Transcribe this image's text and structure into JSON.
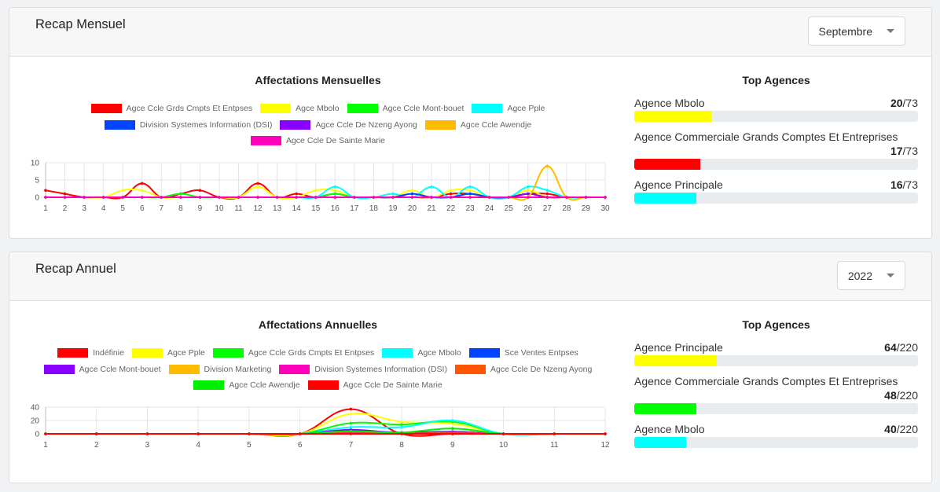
{
  "monthly": {
    "title": "Recap Mensuel",
    "selected_month": "Septembre",
    "top_title": "Top Agences",
    "top": [
      {
        "name": "Agence Mbolo",
        "value": "20",
        "total": "/73",
        "color": "#ffff00",
        "fraction": 0.274
      },
      {
        "name": "Agence Commerciale Grands Comptes Et Entreprises",
        "value": "17",
        "total": "/73",
        "color": "#ff0000",
        "fraction": 0.233
      },
      {
        "name": "Agence Principale",
        "value": "16",
        "total": "/73",
        "color": "#00ffff",
        "fraction": 0.219
      }
    ],
    "chart_data": {
      "type": "line",
      "title": "Affectations Mensuelles",
      "ylim": [
        0,
        10
      ],
      "yticks": [
        "0",
        "5",
        "10"
      ],
      "categories": [
        "1",
        "2",
        "3",
        "4",
        "5",
        "6",
        "7",
        "8",
        "9",
        "10",
        "11",
        "12",
        "13",
        "14",
        "15",
        "16",
        "17",
        "18",
        "19",
        "20",
        "21",
        "22",
        "23",
        "24",
        "25",
        "26",
        "27",
        "28",
        "29",
        "30"
      ],
      "series": [
        {
          "name": "Agce Ccle Grds Cmpts Et Entpses",
          "color": "#ff0000",
          "values": [
            2,
            1,
            0,
            0,
            0,
            4,
            0,
            1,
            2,
            0,
            0,
            4,
            0,
            1,
            0,
            1,
            0,
            0,
            0,
            0,
            0,
            1,
            1,
            0,
            0,
            1,
            1,
            0,
            0,
            0
          ]
        },
        {
          "name": "Agce Mbolo",
          "color": "#ffff00",
          "values": [
            0,
            0,
            0,
            0,
            2,
            2,
            0,
            0,
            0,
            0,
            0,
            3,
            0,
            0,
            2,
            2,
            0,
            0,
            0,
            2,
            0,
            2,
            2,
            0,
            0,
            2,
            0,
            0,
            0,
            0
          ]
        },
        {
          "name": "Agce Ccle Mont-bouet",
          "color": "#00ff00",
          "values": [
            0,
            0,
            0,
            0,
            0,
            0,
            0,
            1,
            0,
            0,
            0,
            0,
            0,
            0,
            0,
            1,
            0,
            0,
            0,
            0,
            0,
            0,
            1,
            0,
            0,
            0,
            0,
            0,
            0,
            0
          ]
        },
        {
          "name": "Agce Pple",
          "color": "#00ffff",
          "values": [
            0,
            0,
            0,
            0,
            0,
            0,
            0,
            0,
            0,
            0,
            0,
            0,
            0,
            0,
            0,
            3,
            0,
            0,
            1,
            0,
            3,
            0,
            3,
            0,
            0,
            3,
            2,
            0,
            0,
            0
          ]
        },
        {
          "name": "Division Systemes Information (DSI)",
          "color": "#0044ff",
          "values": [
            0,
            0,
            0,
            0,
            0,
            0,
            0,
            0,
            0,
            0,
            0,
            0,
            0,
            0,
            0,
            0,
            0,
            0,
            0,
            1,
            0,
            0,
            1,
            0,
            0,
            0,
            0,
            0,
            0,
            0
          ]
        },
        {
          "name": "Agce Ccle De Nzeng Ayong",
          "color": "#8800ff",
          "values": [
            0,
            0,
            0,
            0,
            0,
            0,
            0,
            0,
            0,
            0,
            0,
            0,
            0,
            0,
            0,
            0,
            0,
            0,
            0,
            0,
            0,
            0,
            0,
            0,
            0,
            1,
            0,
            0,
            0,
            0
          ]
        },
        {
          "name": "Agce Ccle Awendje",
          "color": "#ffbb00",
          "values": [
            0,
            0,
            0,
            0,
            0,
            0,
            0,
            0,
            0,
            0,
            0,
            0,
            0,
            0,
            0,
            0,
            0,
            0,
            0,
            0,
            0,
            0,
            0,
            0,
            0,
            0,
            9,
            0,
            0,
            0
          ]
        },
        {
          "name": "Agce Ccle De Sainte Marie",
          "color": "#ff00bb",
          "values": [
            0,
            0,
            0,
            0,
            0,
            0,
            0,
            0,
            0,
            0,
            0,
            0,
            0,
            0,
            0,
            0,
            0,
            0,
            0,
            0,
            0,
            0,
            0,
            0,
            0,
            0,
            0,
            0,
            0,
            0
          ]
        }
      ]
    }
  },
  "annual": {
    "title": "Recap Annuel",
    "selected_year": "2022",
    "top_title": "Top Agences",
    "top": [
      {
        "name": "Agence Principale",
        "value": "64",
        "total": "/220",
        "color": "#ffff00",
        "fraction": 0.291
      },
      {
        "name": "Agence Commerciale Grands Comptes Et Entreprises",
        "value": "48",
        "total": "/220",
        "color": "#00ff00",
        "fraction": 0.218
      },
      {
        "name": "Agence Mbolo",
        "value": "40",
        "total": "/220",
        "color": "#00ffff",
        "fraction": 0.182
      }
    ],
    "chart_data": {
      "type": "line",
      "title": "Affectations Annuelles",
      "ylim": [
        0,
        40
      ],
      "yticks": [
        "0",
        "20",
        "40"
      ],
      "categories": [
        "1",
        "2",
        "3",
        "4",
        "5",
        "6",
        "7",
        "8",
        "9",
        "10",
        "11",
        "12"
      ],
      "series": [
        {
          "name": "Indéfinie",
          "color": "#ff0000",
          "values": [
            0,
            0,
            0,
            0,
            0,
            0,
            37,
            0,
            0,
            0,
            0,
            0
          ]
        },
        {
          "name": "Agce Pple",
          "color": "#ffff00",
          "values": [
            0,
            0,
            0,
            0,
            0,
            0,
            30,
            18,
            15,
            0,
            0,
            0
          ]
        },
        {
          "name": "Agce Ccle Grds Cmpts Et Entpses",
          "color": "#00ff00",
          "values": [
            0,
            0,
            0,
            0,
            0,
            0,
            16,
            14,
            18,
            0,
            0,
            0
          ]
        },
        {
          "name": "Agce Mbolo",
          "color": "#00ffff",
          "values": [
            0,
            0,
            0,
            0,
            0,
            0,
            10,
            10,
            20,
            0,
            0,
            0
          ]
        },
        {
          "name": "Sce Ventes Entpses",
          "color": "#0044ff",
          "values": [
            0,
            0,
            0,
            0,
            0,
            0,
            5,
            2,
            3,
            0,
            0,
            0
          ]
        },
        {
          "name": "Agce Ccle Mont-bouet",
          "color": "#8800ff",
          "values": [
            0,
            0,
            0,
            0,
            0,
            0,
            6,
            1,
            3,
            0,
            0,
            0
          ]
        },
        {
          "name": "Division Marketing",
          "color": "#ffbb00",
          "values": [
            0,
            0,
            0,
            0,
            0,
            0,
            2,
            0,
            1,
            0,
            0,
            0
          ]
        },
        {
          "name": "Division Systemes Information (DSI)",
          "color": "#ff00bb",
          "values": [
            0,
            0,
            0,
            0,
            0,
            0,
            1,
            0,
            2,
            0,
            0,
            0
          ]
        },
        {
          "name": "Agce Ccle De Nzeng Ayong",
          "color": "#ff5500",
          "values": [
            0,
            0,
            0,
            0,
            0,
            0,
            3,
            1,
            1,
            0,
            0,
            0
          ]
        },
        {
          "name": "Agce Ccle Awendje",
          "color": "#00ee00",
          "values": [
            0,
            0,
            0,
            0,
            0,
            0,
            4,
            2,
            8,
            0,
            0,
            0
          ]
        },
        {
          "name": "Agce Ccle De Sainte Marie",
          "color": "#ff0000",
          "values": [
            0,
            0,
            0,
            0,
            0,
            0,
            0,
            0,
            0,
            0,
            0,
            0
          ]
        }
      ]
    }
  }
}
